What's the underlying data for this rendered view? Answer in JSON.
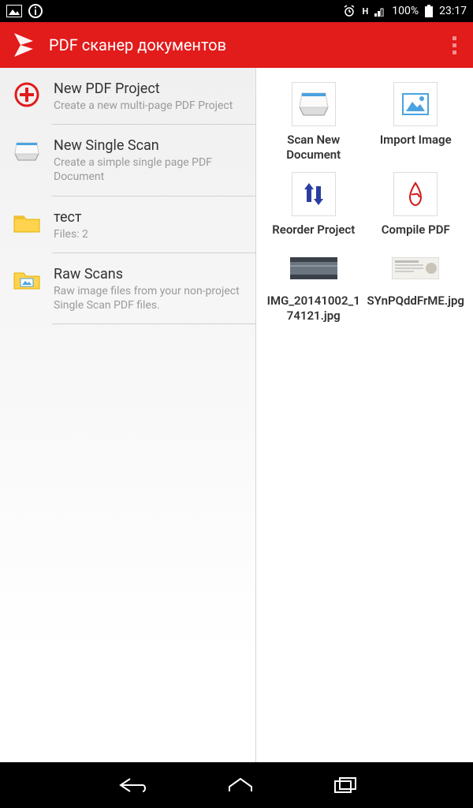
{
  "status": {
    "battery": "100%",
    "clock": "23:17",
    "net_label": "H"
  },
  "appbar": {
    "title": "PDF сканер документов"
  },
  "left": {
    "items": [
      {
        "title": "New PDF Project",
        "subtitle": "Create a new multi-page PDF Project"
      },
      {
        "title": "New Single Scan",
        "subtitle": "Create a simple single page PDF Document"
      },
      {
        "title": "тест",
        "subtitle": "Files: 2"
      },
      {
        "title": "Raw Scans",
        "subtitle": "Raw image files from your non-project Single Scan PDF files."
      }
    ]
  },
  "right": {
    "actions": [
      {
        "label": "Scan New Document"
      },
      {
        "label": "Import Image"
      },
      {
        "label": "Reorder Project"
      },
      {
        "label": "Compile PDF"
      }
    ],
    "files": [
      {
        "label": "IMG_20141002_174121.jpg"
      },
      {
        "label": "SYnPQddFrME.jpg"
      }
    ]
  }
}
